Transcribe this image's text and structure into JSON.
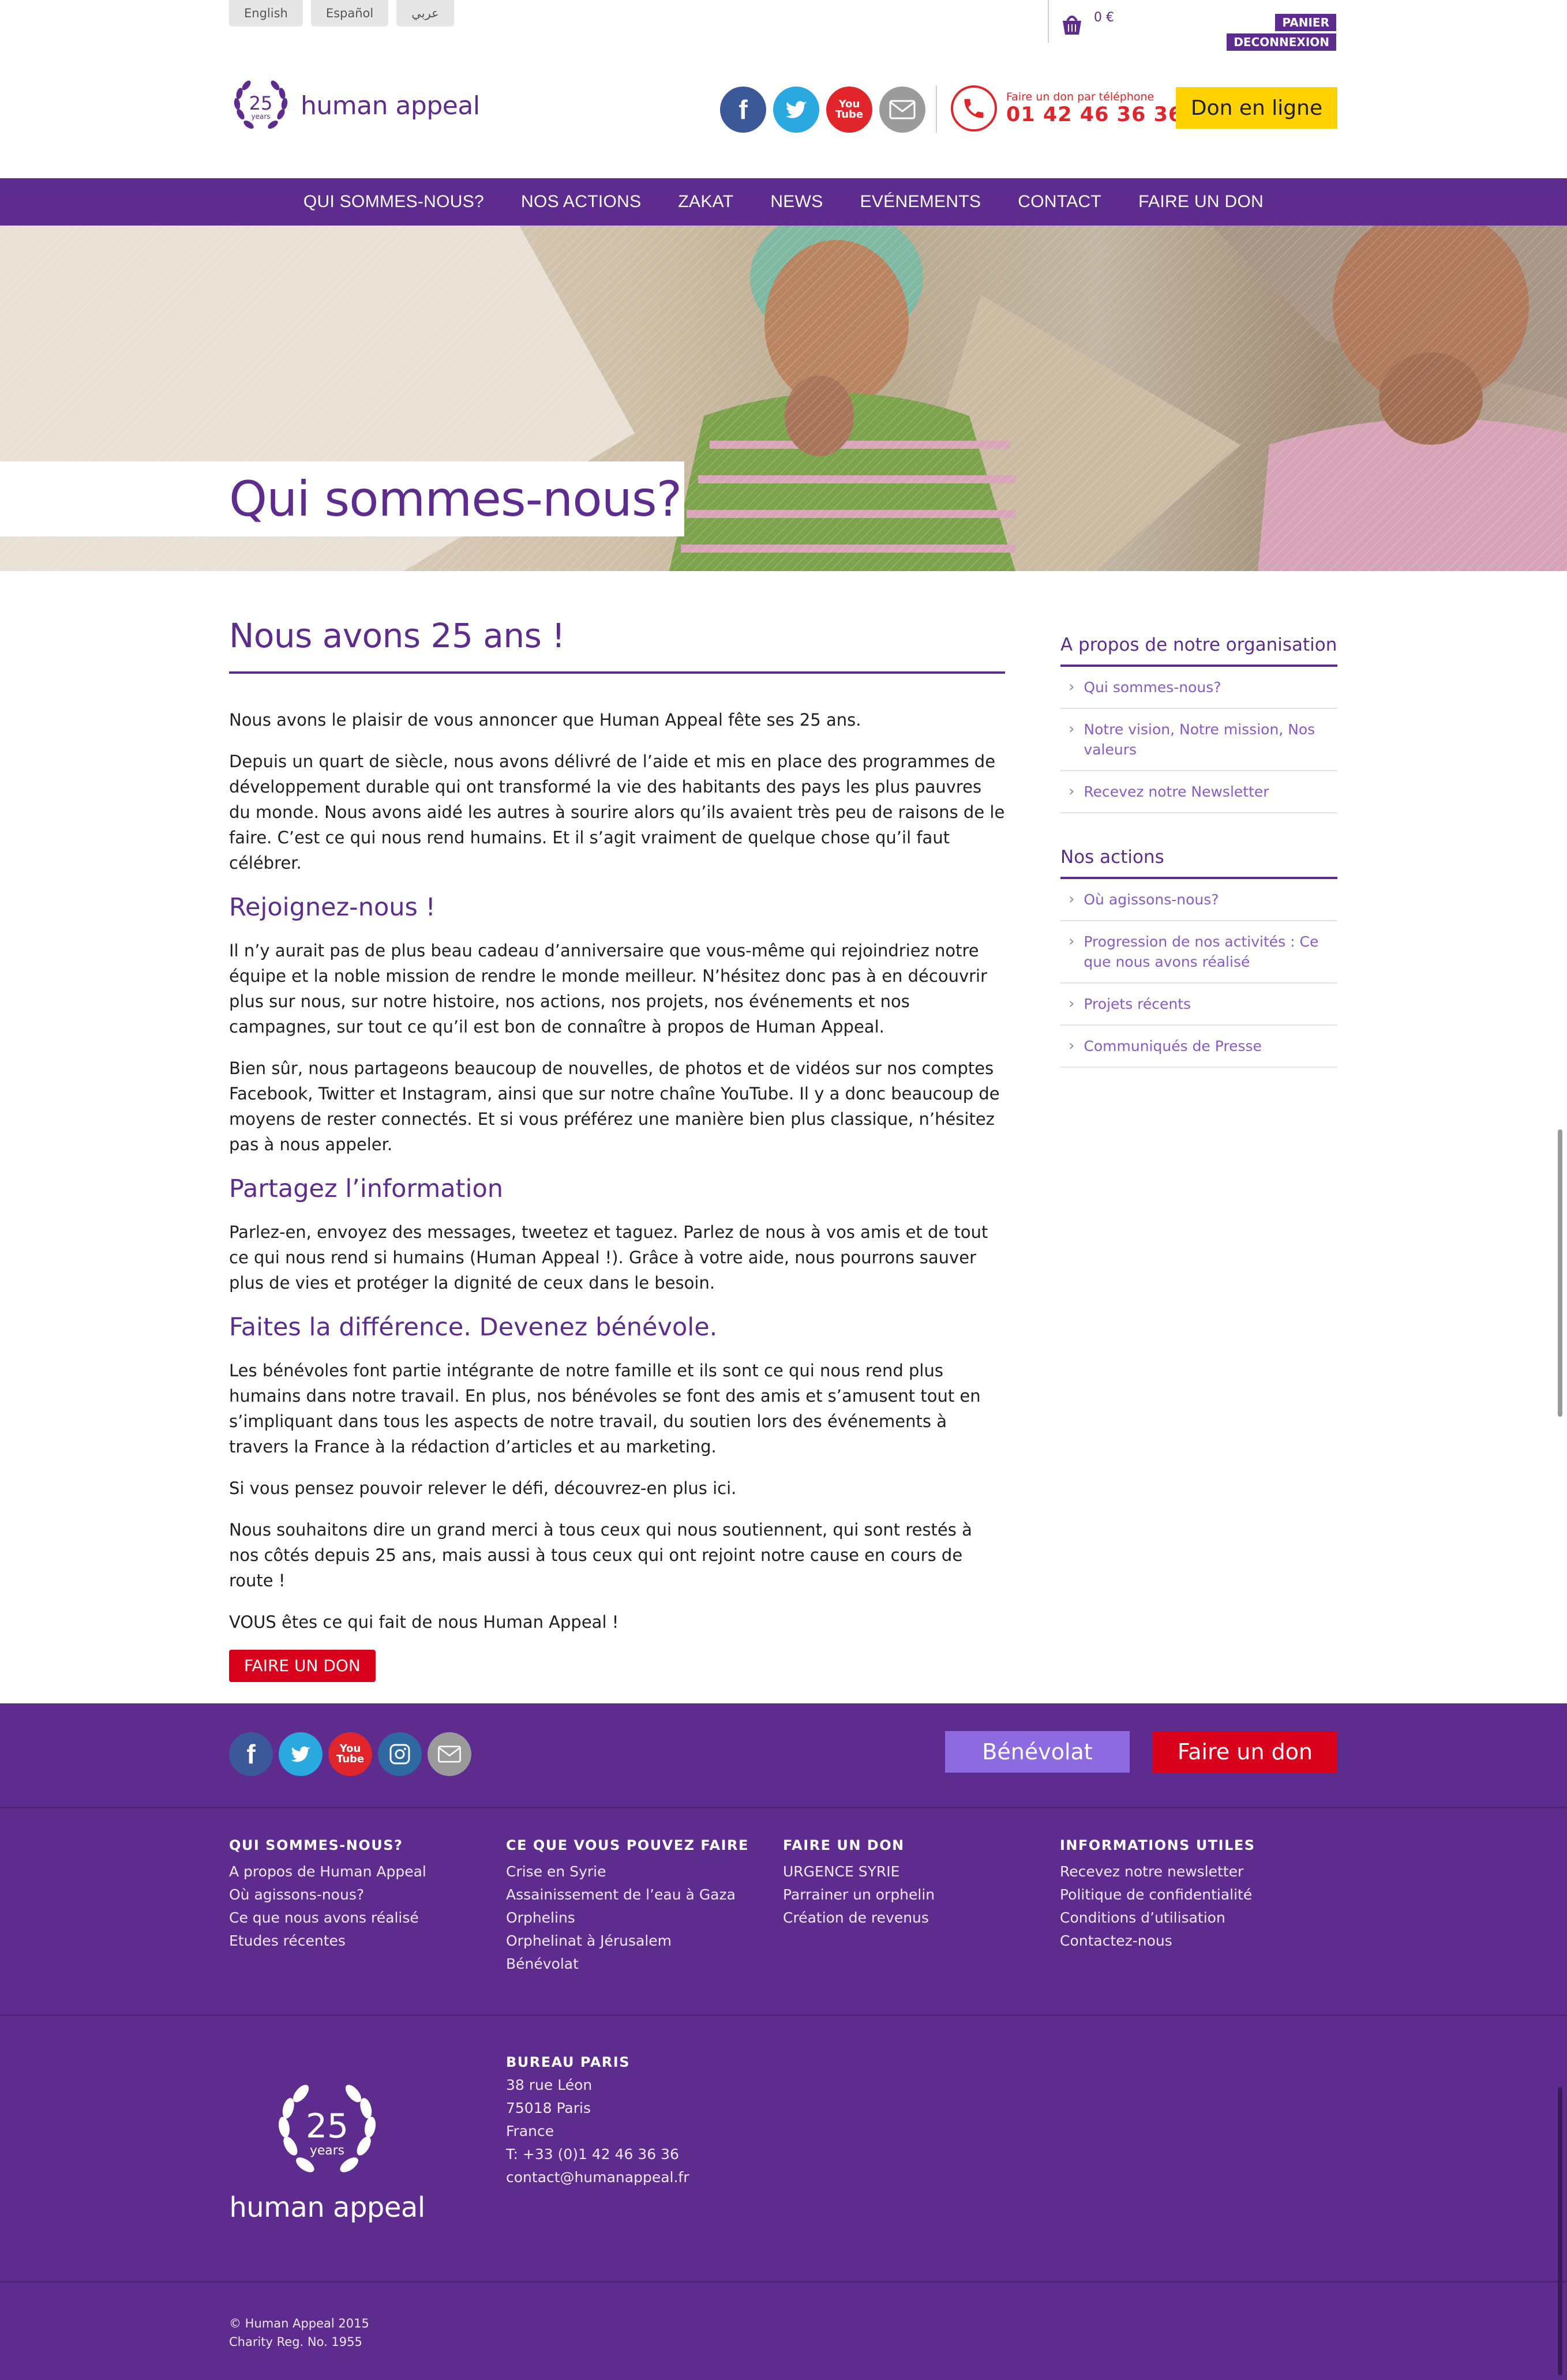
{
  "languages": [
    "English",
    "Español",
    "عربي"
  ],
  "cart": {
    "amount": "0 €"
  },
  "account": {
    "panier": "PANIER",
    "logout": "DECONNEXION"
  },
  "logo": {
    "badge_number": "25",
    "badge_sub": "years",
    "name": "human appeal"
  },
  "phone": {
    "label": "Faire un don par téléphone",
    "number": "01 42 46 36 36"
  },
  "header": {
    "donate_online": "Don en ligne"
  },
  "nav": [
    "QUI SOMMES-NOUS?",
    "NOS ACTIONS",
    "ZAKAT",
    "NEWS",
    "EVÉNEMENTS",
    "CONTACT",
    "FAIRE UN DON"
  ],
  "hero": {
    "title": "Qui sommes-nous?"
  },
  "main": {
    "title": "Nous avons 25 ans !",
    "p1": "Nous avons le plaisir de vous annoncer que Human Appeal fête ses 25 ans.",
    "p2": "Depuis un quart de siècle, nous avons délivré de l’aide et mis en place des programmes de développement durable qui ont transformé la vie des habitants des pays les plus pauvres du monde. Nous avons aidé les autres à sourire alors qu’ils avaient très peu de raisons de le faire. C’est ce qui nous rend humains. Et il s’agit vraiment de quelque chose qu’il faut célébrer.",
    "h2a": "Rejoignez-nous !",
    "p3": "Il n’y aurait pas de plus beau cadeau d’anniversaire que vous-même qui rejoindriez notre équipe et la noble mission de rendre le monde meilleur. N’hésitez donc pas à en découvrir plus sur nous, sur notre histoire, nos actions, nos projets, nos événements et nos campagnes, sur tout ce qu’il est bon de connaître à propos de Human Appeal.",
    "p4": "Bien sûr, nous partageons beaucoup de nouvelles, de photos et de vidéos sur nos comptes Facebook, Twitter et Instagram, ainsi que sur notre chaîne YouTube. Il y a donc beaucoup de moyens de rester connectés. Et si vous préférez une manière bien plus classique, n’hésitez pas à nous appeler.",
    "h2b": "Partagez l’information",
    "p5": "Parlez-en, envoyez des messages, tweetez et taguez. Parlez de nous à vos amis et de tout ce qui nous rend si humains (Human Appeal !). Grâce à votre aide, nous pourrons sauver plus de vies et protéger la dignité de ceux dans le besoin.",
    "h2c": "Faites la différence. Devenez bénévole.",
    "p6": "Les bénévoles font partie intégrante de notre famille et ils sont ce qui nous rend plus humains dans notre travail. En plus, nos bénévoles se font des amis et s’amusent tout en s’impliquant dans tous les aspects de notre travail, du soutien lors des événements à travers la France à la rédaction d’articles et au marketing.",
    "p7": "Si vous pensez pouvoir relever le défi, découvrez-en plus ici.",
    "p8": "Nous souhaitons dire un grand merci à tous ceux qui nous soutiennent, qui sont restés à nos côtés depuis 25 ans, mais aussi à tous ceux qui ont rejoint notre cause en cours de route !",
    "p9": "VOUS êtes ce qui fait de nous Human Appeal !",
    "donate_button": "FAIRE UN DON"
  },
  "sidebar": {
    "section1": {
      "title": "A propos de notre organisation",
      "items": [
        "Qui sommes-nous?",
        "Notre vision, Notre mission, Nos valeurs",
        "Recevez notre Newsletter"
      ]
    },
    "section2": {
      "title": "Nos actions",
      "items": [
        "Où agissons-nous?",
        "Progression de nos activités : Ce que nous avons réalisé",
        "Projets récents",
        "Communiqués de Presse"
      ]
    }
  },
  "footer": {
    "benevolat": "Bénévolat",
    "faire_un_don": "Faire un don",
    "col1": {
      "title": "QUI SOMMES-NOUS?",
      "links": [
        "A propos de Human Appeal",
        "Où agissons-nous?",
        "Ce que nous avons réalisé",
        "Etudes récentes"
      ]
    },
    "col2": {
      "title": "CE QUE VOUS POUVEZ FAIRE",
      "links": [
        "Crise en Syrie",
        "Assainissement de l’eau à Gaza",
        "Orphelins",
        "Orphelinat à Jérusalem",
        "Bénévolat"
      ]
    },
    "col3": {
      "title": "FAIRE UN DON",
      "links": [
        "URGENCE SYRIE",
        "Parrainer un orphelin",
        "Création de revenus"
      ]
    },
    "col4": {
      "title": "INFORMATIONS UTILES",
      "links": [
        "Recevez notre newsletter",
        "Politique de confidentialité",
        "Conditions d’utilisation",
        "Contactez-nous"
      ]
    },
    "bureau": {
      "title": "BUREAU PARIS",
      "lines": [
        "38 rue Léon",
        "75018 Paris",
        "France",
        "T: +33 (0)1 42 46 36 36",
        "contact@humanappeal.fr"
      ]
    },
    "copyright": "© Human Appeal 2015",
    "charity": "Charity Reg. No. 1955"
  },
  "colors": {
    "brand_purple": "#5e2b8e",
    "link_purple": "#8a5bc7",
    "donate_red": "#d9001b",
    "cta_yellow": "#ffd200",
    "benevolat": "#8e6ae0"
  }
}
